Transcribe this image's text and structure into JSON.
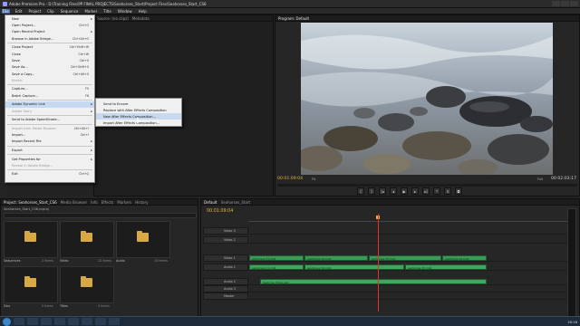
{
  "window": {
    "title": "Adobe Premiere Pro - D:\\Training Files\\PP FINAL PROJECTS\\Seahorses_Start\\Project Files\\Seahorses_Start_CS6"
  },
  "menubar": [
    "File",
    "Edit",
    "Project",
    "Clip",
    "Sequence",
    "Marker",
    "Title",
    "Window",
    "Help"
  ],
  "file_menu": {
    "items": [
      {
        "label": "New",
        "shortcut": "",
        "submenu": true,
        "disabled": false
      },
      {
        "label": "Open Project...",
        "shortcut": "Ctrl+O",
        "disabled": false
      },
      {
        "label": "Open Recent Project",
        "shortcut": "",
        "submenu": true,
        "disabled": false
      },
      {
        "label": "Browse in Adobe Bridge...",
        "shortcut": "Ctrl+Alt+O",
        "disabled": false
      },
      {
        "sep": true
      },
      {
        "label": "Close Project",
        "shortcut": "Ctrl+Shift+W",
        "disabled": false
      },
      {
        "label": "Close",
        "shortcut": "Ctrl+W",
        "disabled": false
      },
      {
        "label": "Save",
        "shortcut": "Ctrl+S",
        "disabled": false
      },
      {
        "label": "Save As...",
        "shortcut": "Ctrl+Shift+S",
        "disabled": false
      },
      {
        "label": "Save a Copy...",
        "shortcut": "Ctrl+Alt+S",
        "disabled": false
      },
      {
        "label": "Revert",
        "shortcut": "",
        "disabled": true
      },
      {
        "sep": true
      },
      {
        "label": "Capture...",
        "shortcut": "F5",
        "disabled": false
      },
      {
        "label": "Batch Capture...",
        "shortcut": "F6",
        "disabled": false
      },
      {
        "sep": true
      },
      {
        "label": "Adobe Dynamic Link",
        "shortcut": "",
        "submenu": true,
        "disabled": false,
        "highlight": true
      },
      {
        "label": "Adobe Story",
        "shortcut": "",
        "submenu": true,
        "disabled": true
      },
      {
        "sep": true
      },
      {
        "label": "Send to Adobe SpeedGrade...",
        "shortcut": "",
        "disabled": false
      },
      {
        "sep": true
      },
      {
        "label": "Import from Media Browser",
        "shortcut": "Ctrl+Alt+I",
        "disabled": true
      },
      {
        "label": "Import...",
        "shortcut": "Ctrl+I",
        "disabled": false
      },
      {
        "label": "Import Recent File",
        "shortcut": "",
        "submenu": true,
        "disabled": false
      },
      {
        "sep": true
      },
      {
        "label": "Export",
        "shortcut": "",
        "submenu": true,
        "disabled": false
      },
      {
        "sep": true
      },
      {
        "label": "Get Properties for",
        "shortcut": "",
        "submenu": true,
        "disabled": false
      },
      {
        "label": "Reveal in Adobe Bridge...",
        "shortcut": "",
        "disabled": true
      },
      {
        "sep": true
      },
      {
        "label": "Exit",
        "shortcut": "Ctrl+Q",
        "disabled": false
      }
    ]
  },
  "dynamic_link_submenu": [
    "Send to Encore",
    "Replace with After Effects Composition",
    "New After Effects Composition...",
    "Import After Effects Composition..."
  ],
  "source_panel": {
    "tabs": [
      "Source: (no clips)",
      "Metadata"
    ]
  },
  "program_monitor": {
    "tab": "Program: Default",
    "timecode_current": "00:01:09:04",
    "timecode_duration": "00:02:03:17",
    "fit": "Fit",
    "quality": "Full"
  },
  "project_panel": {
    "tabs": [
      "Project: Seahorses_Start_CS6",
      "Media Browser",
      "Info",
      "Effects",
      "Markers",
      "History"
    ],
    "project_name": "Seahorses_Start_CS6.prproj",
    "bins": [
      {
        "name": "Sequences",
        "count": "2 Items"
      },
      {
        "name": "Video",
        "count": "22 Items"
      },
      {
        "name": "Audio",
        "count": "15 Items"
      },
      {
        "name": "Dics",
        "count": "5 Items"
      },
      {
        "name": "Titles",
        "count": "4 Items"
      }
    ]
  },
  "timeline": {
    "tabs": [
      "Default",
      "Seahorses_Start"
    ],
    "timecode": "00:01:09:04",
    "tracks": [
      {
        "name": "Video 3",
        "type": "video",
        "clips": []
      },
      {
        "name": "Video 2",
        "type": "video",
        "clips": []
      },
      {
        "name": "Video 1",
        "type": "video",
        "clips": [
          "seahorses_01.mp4",
          "seahorses_02.mp4",
          "seahorses_03.mp4",
          "seahorses_04.mp4"
        ]
      },
      {
        "name": "Audio 1",
        "type": "audio",
        "clips": [
          "seahorses_01.mp4",
          "seahorses_02.mp4",
          "seahorses_03.mp4"
        ]
      },
      {
        "name": "Audio 2",
        "type": "audio",
        "clips": [
          "Seahorse_Music.wav"
        ]
      },
      {
        "name": "Audio 3",
        "type": "audio",
        "clips": []
      },
      {
        "name": "Master",
        "type": "audio",
        "clips": []
      }
    ]
  },
  "taskbar": {
    "clock": "18:18"
  },
  "colors": {
    "accent_timecode": "#e8b23a",
    "clip_green": "#3a9b57",
    "playhead": "#e03030",
    "menu_highlight": "#c6d9f0"
  }
}
